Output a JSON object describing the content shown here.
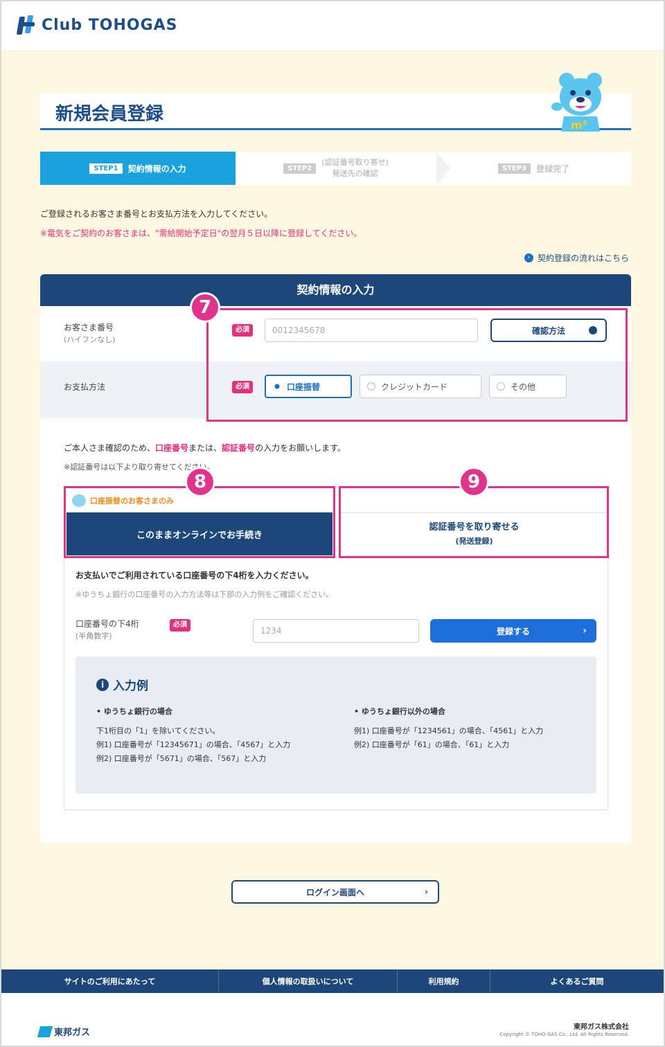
{
  "header": {
    "brand": "Club TOHOGAS"
  },
  "page": {
    "title": "新規会員登録"
  },
  "steps": [
    {
      "badge": "STEP1",
      "label": "契約情報の入力"
    },
    {
      "badge": "STEP2",
      "label_line1": "(認証番号取り寄せ)",
      "label_line2": "発送先の確認"
    },
    {
      "badge": "STEP3",
      "label": "登録完了"
    }
  ],
  "intro": {
    "line1": "ご登録されるお客さま番号とお支払方法を入力してください。",
    "line2": "※電気をご契約のお客さまは、\"需給開始予定日\"の翌月５日以降に登録してください。",
    "flow_link": "契約登録の流れはこちら"
  },
  "form": {
    "heading": "契約情報の入力",
    "required": "必須",
    "customer_number": {
      "label": "お客さま番号",
      "sublabel": "(ハイフンなし)",
      "placeholder": "0012345678",
      "confirm_button": "確認方法"
    },
    "payment": {
      "label": "お支払方法",
      "options": [
        "口座振替",
        "クレジットカード",
        "その他"
      ],
      "selected": "口座振替"
    },
    "verify_note_a": "ご本人さま確認のため、",
    "verify_note_b": "口座番号",
    "verify_note_c": "または、",
    "verify_note_d": "認証番号",
    "verify_note_e": "の入力をお願いします。",
    "verify_note2": "※認証番号は以下より取り寄せてください。",
    "online_tag": "口座振替のお客さまのみ",
    "online_button": "このままオンラインでお手続き",
    "auth_button": "認証番号を取り寄せる",
    "auth_button_sub": "(発送登録)",
    "account": {
      "instruction": "お支払いでご利用されている口座番号の下4桁を入力ください。",
      "note": "※ゆうちょ銀行の口座番号の入力方法等は下部の入力例をご確認ください。",
      "label": "口座番号の下4桁",
      "sublabel": "(半角数字)",
      "placeholder": "1234",
      "submit": "登録する"
    },
    "example": {
      "title": "入力例",
      "yucho_head": "• ゆうちょ銀行の場合",
      "yucho_l1": "下1桁目の「1」を除いてください。",
      "yucho_l2": "例1) 口座番号が「12345671」の場合、「4567」と入力",
      "yucho_l3": "例2) 口座番号が「5671」の場合、「567」と入力",
      "other_head": "• ゆうちょ銀行以外の場合",
      "other_l1": "例1) 口座番号が「1234561」の場合、「4561」と入力",
      "other_l2": "例2) 口座番号が「61」の場合、「61」と入力"
    }
  },
  "callouts": [
    "7",
    "8",
    "9"
  ],
  "login_button": "ログイン画面へ",
  "footer": {
    "nav": [
      "サイトのご利用にあたって",
      "個人情報の取扱いについて",
      "利用規約",
      "よくあるご質問"
    ],
    "logo": "東邦ガス",
    "company": "東邦ガス株式会社",
    "copyright": "Copyright © TOHO GAS Co., Ltd. All Rights Reserved."
  },
  "colors": {
    "navy": "#1d4779",
    "accent_blue": "#1aa2df",
    "pink": "#e0338b",
    "bg": "#fdf8df"
  }
}
